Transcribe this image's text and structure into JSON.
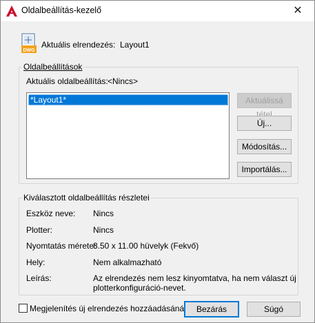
{
  "window": {
    "title": "Oldalbeállítás-kezelő",
    "close_glyph": "✕"
  },
  "current_layout": {
    "label": "Aktuális elrendezés:",
    "value": "Layout1",
    "icon": "dwg-file-icon"
  },
  "page_setups": {
    "group_title": "Oldalbeállítások",
    "current_label": "Aktuális oldalbeállítás:",
    "current_value": "<Nincs>",
    "items": [
      "*Layout1*"
    ],
    "selected_index": 0
  },
  "buttons": {
    "set_current": "Aktuálissá tétel",
    "new": "Új...",
    "modify": "Módosítás...",
    "import": "Importálás...",
    "close": "Bezárás",
    "help": "Súgó"
  },
  "details": {
    "group_title": "Kiválasztott oldalbeállítás részletei",
    "rows": [
      {
        "label": "Eszköz neve:",
        "value": "Nincs"
      },
      {
        "label": "Plotter:",
        "value": "Nincs"
      },
      {
        "label": "Nyomtatás mérete:",
        "value": "8.50 x 11.00 hüvelyk (Fekvő)"
      },
      {
        "label": "Hely:",
        "value": "Nem alkalmazható"
      },
      {
        "label": "Leírás:",
        "value_line1": "Az elrendezés nem lesz kinyomtatva, ha nem választ új",
        "value_line2": "plotterkonfiguráció-nevet."
      }
    ]
  },
  "show_on_new_layout": {
    "label": "Megjelenítés új elrendezés hozzáadásánál",
    "checked": false
  },
  "colors": {
    "accent": "#0078d7",
    "autocad_red": "#c8102e"
  }
}
